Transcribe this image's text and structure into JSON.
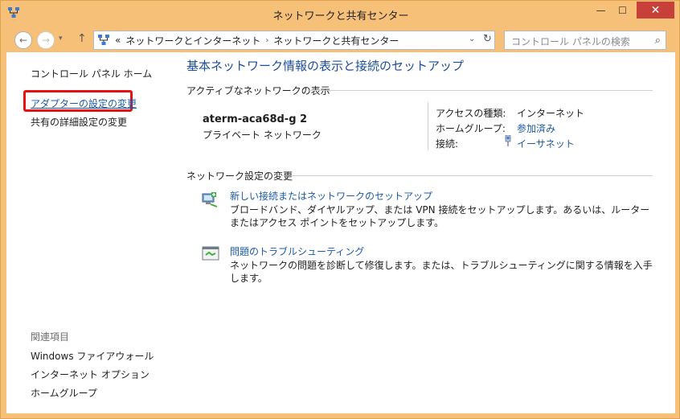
{
  "window": {
    "title": "ネットワークと共有センター",
    "minimize": "—",
    "maximize": "☐",
    "close": "✕"
  },
  "nav": {
    "back": "←",
    "forward": "→",
    "recent": "▾",
    "up": "↑",
    "address_prefix": "«",
    "breadcrumb": [
      "ネットワークとインターネット",
      "ネットワークと共有センター"
    ],
    "breadcrumb_sep": "›",
    "dropdown": "⌄",
    "refresh": "↻",
    "search_placeholder": "コントロール パネルの検索",
    "search_icon": "⌕"
  },
  "sidebar": {
    "home": "コントロール パネル ホーム",
    "adapter": "アダプターの設定の変更",
    "advanced": "共有の詳細設定の変更",
    "related_heading": "関連項目",
    "related": [
      "Windows ファイアウォール",
      "インターネット オプション",
      "ホームグループ"
    ]
  },
  "main": {
    "title": "基本ネットワーク情報の表示と接続のセットアップ",
    "active_heading": "アクティブなネットワークの表示",
    "network_name": "aterm-aca68d-g  2",
    "network_type": "プライベート ネットワーク",
    "access_label": "アクセスの種類:",
    "access_value": "インターネット",
    "homegroup_label": "ホームグループ:",
    "homegroup_value": "参加済み",
    "connection_label": "接続:",
    "connection_value": "イーサネット",
    "settings_heading": "ネットワーク設定の変更",
    "task1_title": "新しい接続またはネットワークのセットアップ",
    "task1_desc": "ブロードバンド、ダイヤルアップ、または VPN 接続をセットアップします。あるいは、ルーターまたはアクセス ポイントをセットアップします。",
    "task2_title": "問題のトラブルシューティング",
    "task2_desc": "ネットワークの問題を診断して修復します。または、トラブルシューティングに関する情報を入手します。"
  },
  "colors": {
    "frame": "#f6c079",
    "link": "#1a5aa8",
    "title": "#1c4e99",
    "highlight": "#e81010",
    "close": "#c7403a"
  }
}
